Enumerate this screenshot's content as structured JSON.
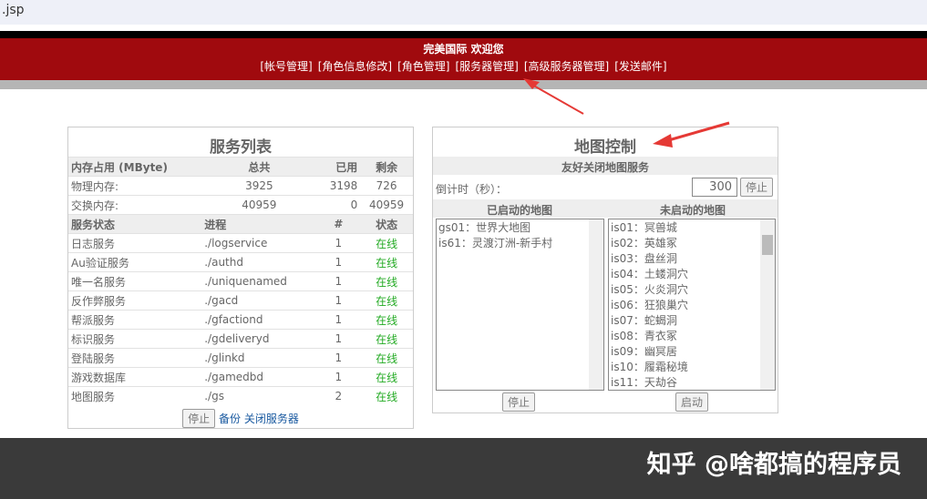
{
  "address": ".jsp",
  "header": {
    "title": "完美国际 欢迎您",
    "nav": [
      "[帐号管理]",
      "[角色信息修改]",
      "[角色管理]",
      "[服务器管理]",
      "[高级服务器管理]",
      "[发送邮件]"
    ]
  },
  "services": {
    "title": "服务列表",
    "mem_header": [
      "内存占用 (MByte)",
      "总共",
      "已用",
      "剩余"
    ],
    "mem_rows": [
      [
        "物理内存:",
        "3925",
        "3198",
        "726"
      ],
      [
        "交换内存:",
        "40959",
        "0",
        "40959"
      ]
    ],
    "svc_header": [
      "服务状态",
      "进程",
      "#",
      "状态"
    ],
    "svc_rows": [
      [
        "日志服务",
        "./logservice",
        "1",
        "在线"
      ],
      [
        "Au验证服务",
        "./authd",
        "1",
        "在线"
      ],
      [
        "唯一名服务",
        "./uniquenamed",
        "1",
        "在线"
      ],
      [
        "反作弊服务",
        "./gacd",
        "1",
        "在线"
      ],
      [
        "帮派服务",
        "./gfactiond",
        "1",
        "在线"
      ],
      [
        "标识服务",
        "./gdeliveryd",
        "1",
        "在线"
      ],
      [
        "登陆服务",
        "./glinkd",
        "1",
        "在线"
      ],
      [
        "游戏数据库",
        "./gamedbd",
        "1",
        "在线"
      ],
      [
        "地图服务",
        "./gs",
        "2",
        "在线"
      ]
    ],
    "stop": "停止",
    "backup_link": "备份 关闭服务器"
  },
  "map": {
    "title": "地图控制",
    "subtitle": "友好关闭地图服务",
    "countdown_label": "倒计时（秒）：",
    "countdown_value": "300",
    "countdown_stop": "停止",
    "started_label": "已启动的地图",
    "stopped_label": "未启动的地图",
    "started": [
      "gs01：世界大地图",
      "is61：灵渡汀洲-新手村"
    ],
    "stopped": [
      "is01：冥兽城",
      "is02：英雄冢",
      "is03：盘丝洞",
      "is04：土蝼洞穴",
      "is05：火炎洞穴",
      "is06：狂狼巢穴",
      "is07：蛇蝎洞",
      "is08：青衣冢",
      "is09：幽冥居",
      "is10：履霜秘境",
      "is11：天劫谷"
    ],
    "stop": "停止",
    "start": "启动"
  },
  "watermark": "知乎 @啥都搞的程序员"
}
